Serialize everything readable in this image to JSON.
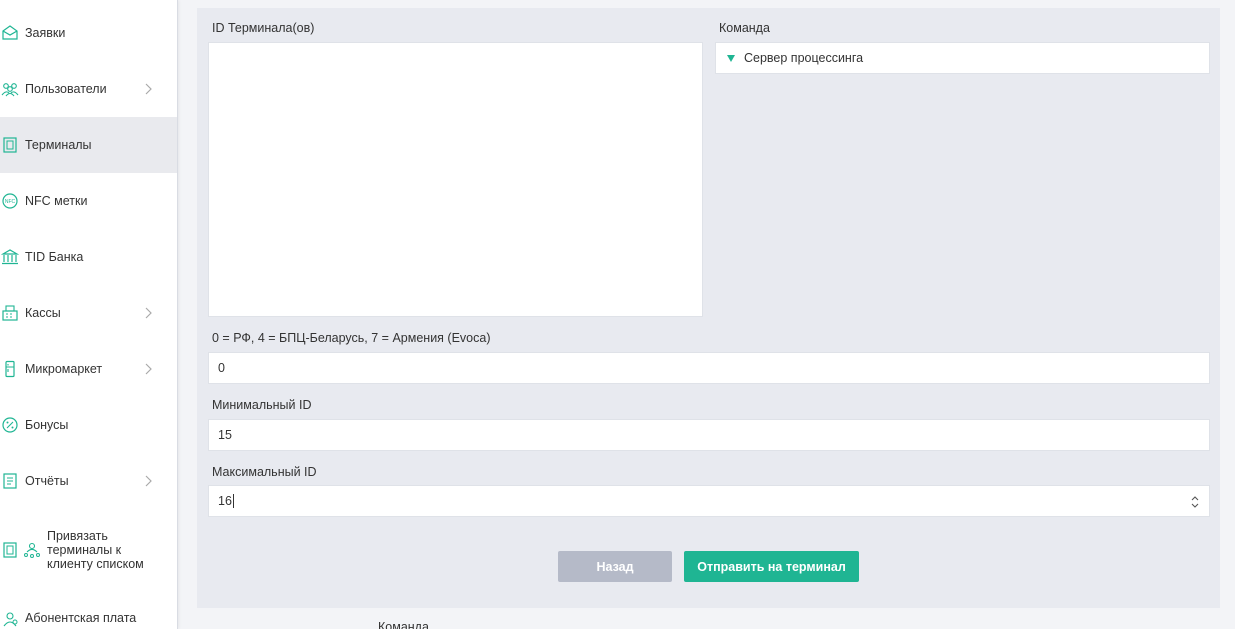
{
  "sidebar": {
    "items": [
      {
        "label": "Заявки",
        "icon": "envelope-icon"
      },
      {
        "label": "Пользователи",
        "icon": "users-icon"
      },
      {
        "label": "Терминалы",
        "icon": "terminal-icon"
      },
      {
        "label": "NFC метки",
        "icon": "nfc-icon"
      },
      {
        "label": "TID Банка",
        "icon": "bank-icon"
      },
      {
        "label": "Кассы",
        "icon": "register-icon"
      },
      {
        "label": "Микромаркет",
        "icon": "fridge-icon"
      },
      {
        "label": "Бонусы",
        "icon": "percent-icon"
      },
      {
        "label": "Отчёты",
        "icon": "report-icon"
      },
      {
        "label": "Привязать терминалы к клиенту списком",
        "icon": "link-terminals-icon"
      },
      {
        "label": "Абонентская плата",
        "icon": "subscription-icon"
      }
    ],
    "accent": "#1fb593"
  },
  "form": {
    "terminal_ids_label": "ID Терминала(ов)",
    "terminal_ids_value": "",
    "command_label": "Команда",
    "command_value": "Сервер процессинга",
    "processing_label": "0 = РФ, 4 = БПЦ-Беларусь, 7 = Армения (Evoca)",
    "processing_value": "0",
    "min_id_label": "Минимальный ID",
    "min_id_value": "15",
    "max_id_label": "Максимальный ID",
    "max_id_value": "16",
    "back_button": "Назад",
    "send_button": "Отправить на терминал"
  },
  "below": {
    "command_label": "Команда"
  }
}
